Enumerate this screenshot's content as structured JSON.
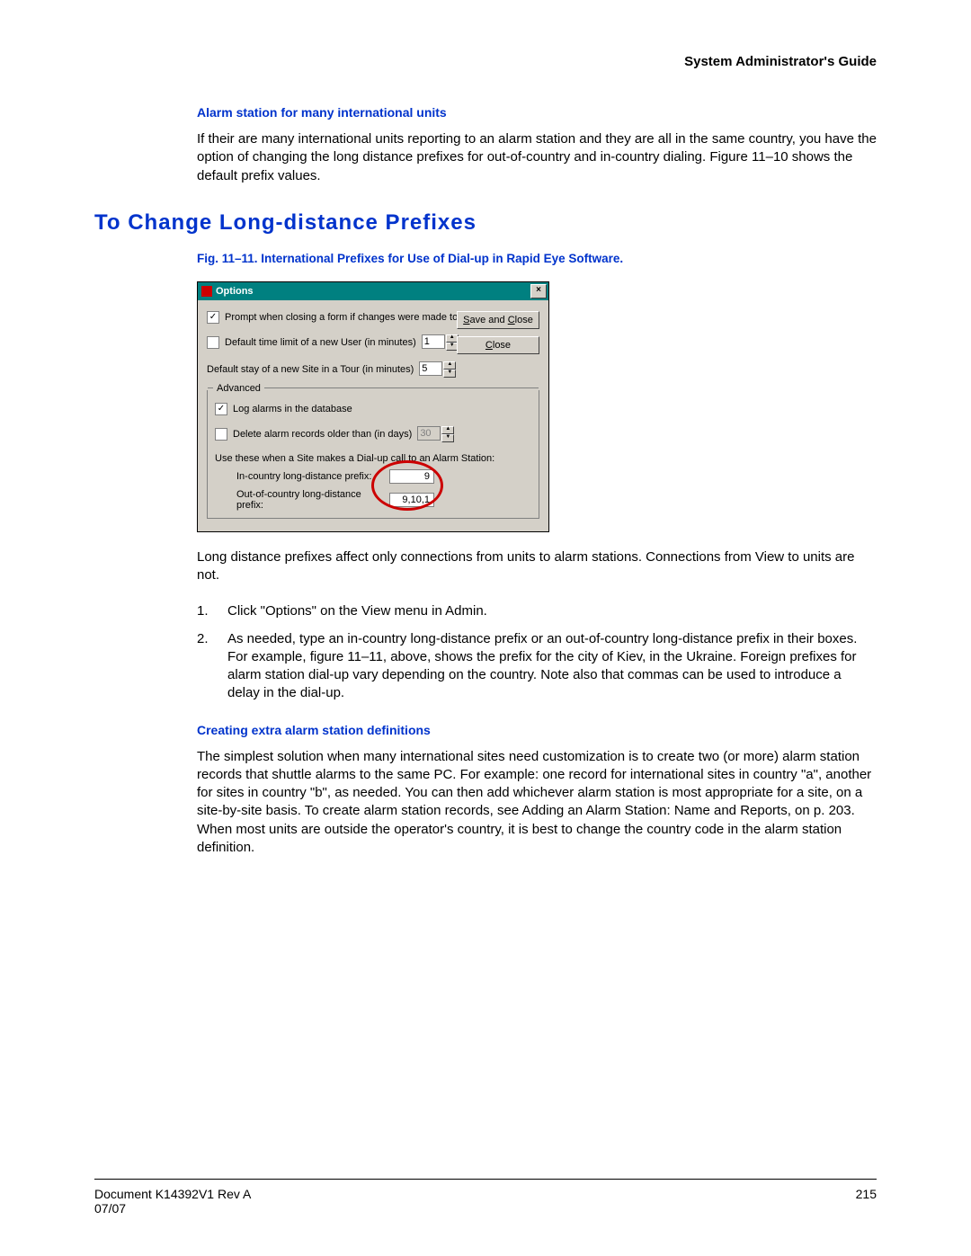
{
  "header": {
    "guide": "System Administrator's Guide"
  },
  "sub1": {
    "title": "Alarm station for many international units",
    "body": "If their are many international units reporting to an alarm station and they are all in the same country, you have the option of changing the long distance prefixes for out-of-country and in-country dialing. Figure 11–10 shows the default prefix values."
  },
  "section": {
    "title": "To Change Long-distance Prefixes"
  },
  "figure": {
    "caption": "Fig. 11–11.  International Prefixes for Use of Dial-up in Rapid Eye Software."
  },
  "dialog": {
    "title": "Options",
    "close": "×",
    "save_btn_pre": "S",
    "save_btn_mid": "ave and ",
    "save_btn_u2": "C",
    "save_btn_post": "lose",
    "close_btn_u": "C",
    "close_btn_rest": "lose",
    "prompt_label": "Prompt when closing a form if changes were made to the form",
    "default_time_label": "Default time limit of a new User (in minutes)",
    "default_time_value": "1",
    "default_stay_label": "Default stay of a new Site in a Tour (in minutes)",
    "default_stay_value": "5",
    "advanced_label": "Advanced",
    "log_alarms_label": "Log alarms in the database",
    "delete_records_label": "Delete alarm records older than (in days)",
    "delete_records_value": "30",
    "use_these_label": "Use these when a Site makes a Dial-up call to an Alarm Station:",
    "in_country_label": "In-country long-distance prefix:",
    "in_country_value": "9",
    "out_country_label": "Out-of-country long-distance prefix:",
    "out_country_value": "9,10,1"
  },
  "after_fig": "Long distance prefixes affect only connections from units to alarm stations. Connections from View to units are not.",
  "steps": {
    "s1": "Click \"Options\" on the View menu in Admin.",
    "s2": "As needed, type an in-country long-distance prefix or an out-of-country long-distance prefix in their boxes. For example, figure 11–11, above, shows the prefix for the city of Kiev, in the Ukraine. Foreign prefixes for alarm station dial-up vary depending on the country. Note also that commas can be used to introduce a delay in the dial-up."
  },
  "sub2": {
    "title": "Creating extra alarm station definitions",
    "body": "The simplest solution when many international sites need customization is to create two (or more) alarm station records that shuttle alarms to the same PC. For example: one record for international sites in country \"a\", another for sites in country \"b\", as needed. You can then add whichever alarm station is most appropriate for a site, on a site-by-site basis. To create alarm station records, see Adding an Alarm Station: Name and Reports, on p. 203. When most units are outside the operator's country, it is best to change the country code in the alarm station definition."
  },
  "footer": {
    "doc": "Document K14392V1 Rev A",
    "date": "07/07",
    "page": "215"
  }
}
